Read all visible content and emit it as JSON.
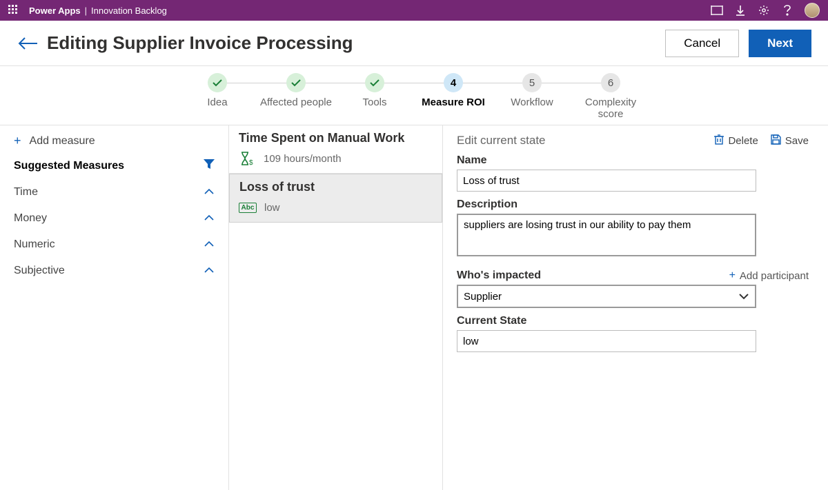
{
  "topbar": {
    "brand": "Power Apps",
    "app": "Innovation Backlog"
  },
  "header": {
    "title": "Editing Supplier Invoice Processing",
    "cancel": "Cancel",
    "next": "Next"
  },
  "steps": {
    "s1": "Idea",
    "s2": "Affected people",
    "s3": "Tools",
    "s4_num": "4",
    "s4": "Measure ROI",
    "s5_num": "5",
    "s5": "Workflow",
    "s6_num": "6",
    "s6": "Complexity score"
  },
  "sidebar": {
    "add": "Add measure",
    "suggested": "Suggested Measures",
    "cats": {
      "time": "Time",
      "money": "Money",
      "numeric": "Numeric",
      "subjective": "Subjective"
    }
  },
  "measures": {
    "m1": {
      "title": "Time Spent on Manual Work",
      "value": "109 hours/month"
    },
    "m2": {
      "title": "Loss of trust",
      "badge": "Abc",
      "value": "low"
    }
  },
  "detail": {
    "heading": "Edit current state",
    "delete": "Delete",
    "save": "Save",
    "name_label": "Name",
    "name_value": "Loss of trust",
    "desc_label": "Description",
    "desc_value": "suppliers are losing trust in our ability to pay them",
    "impact_label": "Who's impacted",
    "add_participant": "Add participant",
    "impact_value": "Supplier",
    "state_label": "Current State",
    "state_value": "low"
  }
}
